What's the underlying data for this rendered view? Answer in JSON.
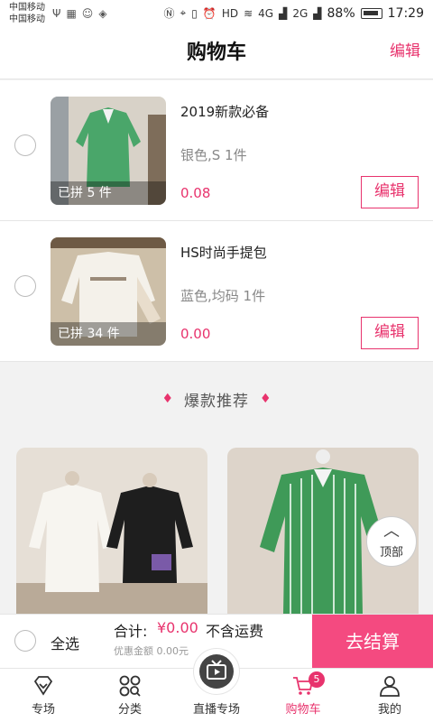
{
  "status_bar": {
    "carrier1": "中国移动",
    "carrier2": "中国移动",
    "network1": "4G",
    "network2": "2G",
    "battery": "88%",
    "time": "17:29",
    "hd_label": "HD"
  },
  "header": {
    "title": "购物车",
    "edit_label": "编辑"
  },
  "cart_items": [
    {
      "name": "2019新款必备",
      "spec": "银色,S  1件",
      "price": "0.08",
      "group_count": "已拼 5 件",
      "edit_label": "编辑"
    },
    {
      "name": "HS时尚手提包",
      "spec": "蓝色,均码  1件",
      "price": "0.00",
      "group_count": "已拼 34 件",
      "edit_label": "编辑"
    }
  ],
  "recommend": {
    "title": "爆款推荐"
  },
  "top_button": {
    "label": "顶部"
  },
  "checkout": {
    "select_all": "全选",
    "total_label": "合计:",
    "total_value": "¥0.00",
    "shipping_note": "不含运费",
    "discount": "优惠金额 0.00元",
    "pay_button": "去结算"
  },
  "tabbar": {
    "tabs": [
      {
        "label": "专场",
        "icon": "diamond-icon"
      },
      {
        "label": "分类",
        "icon": "category-icon"
      },
      {
        "label": "直播专场",
        "icon": "live-tv-icon"
      },
      {
        "label": "购物车",
        "icon": "cart-icon"
      },
      {
        "label": "我的",
        "icon": "user-icon"
      }
    ],
    "cart_badge": "5",
    "active_tab": "购物车"
  },
  "colors": {
    "accent": "#e8336d",
    "pay_button_bg": "#f44a80"
  }
}
